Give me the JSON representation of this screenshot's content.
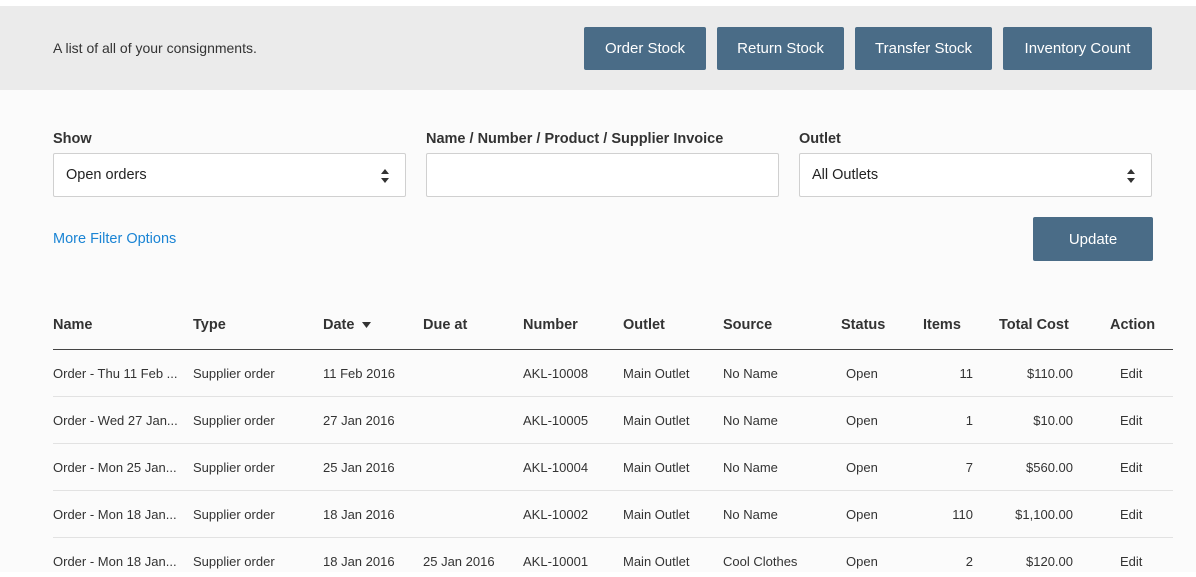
{
  "header": {
    "description": "A list of all of your consignments.",
    "buttons": {
      "order_stock": "Order Stock",
      "return_stock": "Return Stock",
      "transfer_stock": "Transfer Stock",
      "inventory_count": "Inventory Count"
    }
  },
  "filters": {
    "show": {
      "label": "Show",
      "value": "Open orders"
    },
    "search": {
      "label": "Name / Number / Product / Supplier Invoice",
      "value": "",
      "placeholder": ""
    },
    "outlet": {
      "label": "Outlet",
      "value": "All Outlets"
    },
    "more_filter_options": "More Filter Options",
    "update": "Update"
  },
  "table": {
    "columns": {
      "name": "Name",
      "type": "Type",
      "date": "Date",
      "due_at": "Due at",
      "number": "Number",
      "outlet": "Outlet",
      "source": "Source",
      "status": "Status",
      "items": "Items",
      "total_cost": "Total Cost",
      "action": "Action"
    },
    "sort_icon": "caret-down-icon",
    "rows": [
      {
        "name": "Order - Thu 11 Feb ...",
        "type": "Supplier order",
        "date": "11 Feb 2016",
        "due_at": "",
        "number": "AKL-10008",
        "outlet": "Main Outlet",
        "source": "No Name",
        "status": "Open",
        "items": "11",
        "total_cost": "$110.00",
        "action": "Edit"
      },
      {
        "name": "Order - Wed 27 Jan...",
        "type": "Supplier order",
        "date": "27 Jan 2016",
        "due_at": "",
        "number": "AKL-10005",
        "outlet": "Main Outlet",
        "source": "No Name",
        "status": "Open",
        "items": "1",
        "total_cost": "$10.00",
        "action": "Edit"
      },
      {
        "name": "Order - Mon 25 Jan...",
        "type": "Supplier order",
        "date": "25 Jan 2016",
        "due_at": "",
        "number": "AKL-10004",
        "outlet": "Main Outlet",
        "source": "No Name",
        "status": "Open",
        "items": "7",
        "total_cost": "$560.00",
        "action": "Edit"
      },
      {
        "name": "Order - Mon 18 Jan...",
        "type": "Supplier order",
        "date": "18 Jan 2016",
        "due_at": "",
        "number": "AKL-10002",
        "outlet": "Main Outlet",
        "source": "No Name",
        "status": "Open",
        "items": "110",
        "total_cost": "$1,100.00",
        "action": "Edit"
      },
      {
        "name": "Order - Mon 18 Jan...",
        "type": "Supplier order",
        "date": "18 Jan 2016",
        "due_at": "25 Jan 2016",
        "number": "AKL-10001",
        "outlet": "Main Outlet",
        "source": "Cool Clothes",
        "status": "Open",
        "items": "2",
        "total_cost": "$120.00",
        "action": "Edit"
      }
    ]
  },
  "colors": {
    "primary_button": "#4a6c87",
    "link": "#1a84d4",
    "header_bg": "#ebebeb"
  }
}
